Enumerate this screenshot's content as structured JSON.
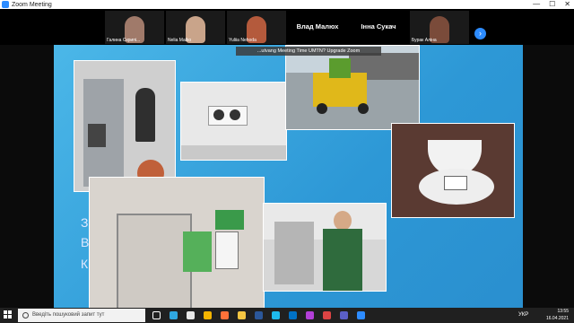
{
  "window": {
    "title": "Zoom Meeting",
    "controls": [
      "—",
      "☐",
      "✕"
    ]
  },
  "gallery": {
    "participants": [
      {
        "name": "Галина Скрипі...",
        "color": "#a07a6a"
      },
      {
        "name": "Nelia Malko",
        "color": "#c9a48a"
      },
      {
        "name": "Yuliia Nehoda",
        "color": "#b45a3c"
      },
      {
        "name": "Влад Малюх",
        "video": false
      },
      {
        "name": "Інна Сукач",
        "video": false
      },
      {
        "name": "Бурак Аліна",
        "color": "#7a4b3a"
      }
    ],
    "next_icon": "›"
  },
  "slide": {
    "recording_banner": "...utvang Meeting Time UMTN? Upgrade Zoom",
    "side_text": [
      "З",
      "В",
      "К"
    ]
  },
  "taskbar": {
    "search_placeholder": "Введіть пошуковий запит тут",
    "tray_lang": "УКР",
    "time": "13:55",
    "date": "16.04.2021",
    "icons": [
      {
        "name": "task-view-icon",
        "color": "#ffffff"
      },
      {
        "name": "edge-icon",
        "color": "#2fa7e0"
      },
      {
        "name": "store-icon",
        "color": "#e8e8e8"
      },
      {
        "name": "chrome-icon",
        "color": "#f4b400"
      },
      {
        "name": "firefox-icon",
        "color": "#ff7139"
      },
      {
        "name": "file-explorer-icon",
        "color": "#f5c542"
      },
      {
        "name": "word-icon",
        "color": "#2b579a"
      },
      {
        "name": "edge-alt-icon",
        "color": "#1ebbee"
      },
      {
        "name": "outlook-icon",
        "color": "#0072c6"
      },
      {
        "name": "photos-icon",
        "color": "#b33fd8"
      },
      {
        "name": "media-icon",
        "color": "#d44"
      },
      {
        "name": "teams-icon",
        "color": "#5b5fc7"
      },
      {
        "name": "zoom-icon",
        "color": "#2d8cff"
      }
    ]
  }
}
